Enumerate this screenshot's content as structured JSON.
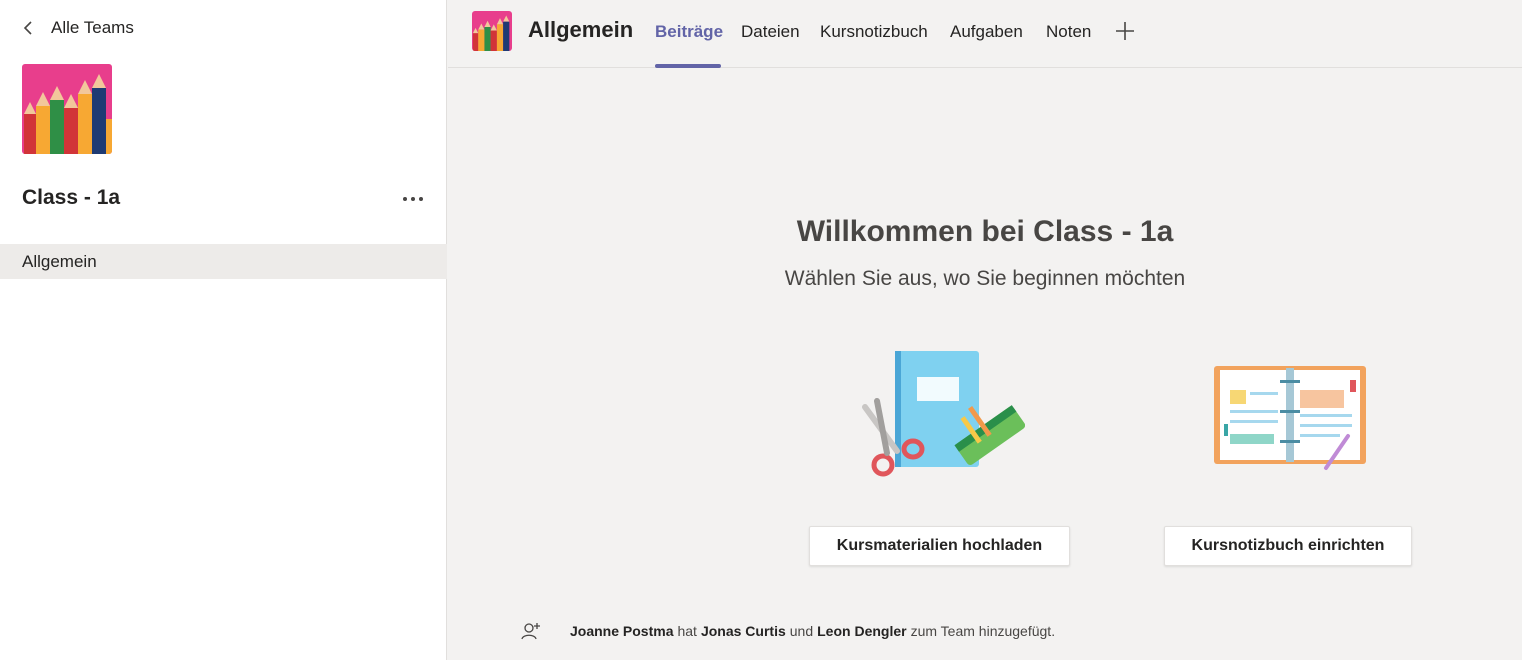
{
  "sidebar": {
    "back_label": "Alle Teams",
    "team_name": "Class - 1a",
    "channels": [
      {
        "label": "Allgemein",
        "active": true
      }
    ]
  },
  "header": {
    "channel_title": "Allgemein",
    "tabs": [
      {
        "label": "Beiträge",
        "active": true
      },
      {
        "label": "Dateien",
        "active": false
      },
      {
        "label": "Kursnotizbuch",
        "active": false
      },
      {
        "label": "Aufgaben",
        "active": false
      },
      {
        "label": "Noten",
        "active": false
      }
    ]
  },
  "main": {
    "welcome_title": "Willkommen bei Class - 1a",
    "welcome_subtitle": "Wählen Sie aus, wo Sie beginnen möchten",
    "actions": {
      "upload_label": "Kursmaterialien hochladen",
      "notebook_label": "Kursnotizbuch einrichten"
    }
  },
  "activity": {
    "actor": "Joanne Postma",
    "verb": "hat",
    "member1": "Jonas Curtis",
    "conj": "und",
    "member2": "Leon Dengler",
    "rest": "zum Team hinzugefügt."
  },
  "colors": {
    "accent": "#6264a7",
    "sidebar_bg": "#ffffff",
    "main_bg": "#f3f2f1",
    "selected_channel_bg": "#edebe9"
  },
  "icons": {
    "back": "chevron-left-icon",
    "more": "more-horizontal-icon",
    "add_tab": "plus-icon",
    "activity": "add-person-icon"
  }
}
